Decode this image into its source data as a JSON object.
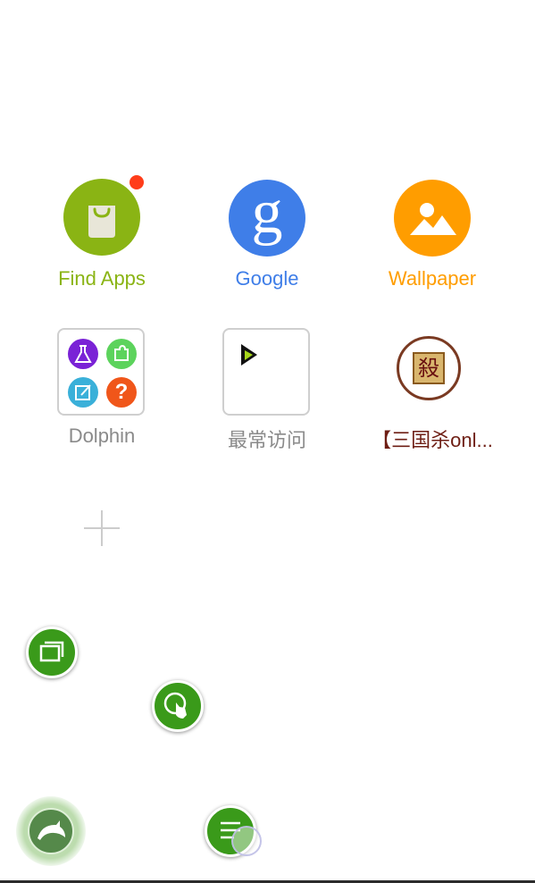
{
  "apps": [
    {
      "label": "Find Apps",
      "color": "#8ab414",
      "icon": "shopping-bag-icon",
      "badge": true,
      "badge_color": "#ff3d1a"
    },
    {
      "label": "Google",
      "color": "#3f7ee8",
      "icon": "google-icon",
      "glyph": "g"
    },
    {
      "label": "Wallpaper",
      "color": "#ff9d00",
      "icon": "image-icon"
    },
    {
      "label": "Dolphin",
      "color": "#8a8a8a",
      "icon": "folder-icon",
      "folder_items": [
        {
          "icon": "flask-icon",
          "color": "#7a22d6"
        },
        {
          "icon": "puzzle-icon",
          "color": "#5cd35c"
        },
        {
          "icon": "edit-icon",
          "color": "#3ab0d9"
        },
        {
          "icon": "help-icon",
          "color": "#f0561a",
          "glyph": "?"
        }
      ]
    },
    {
      "label": "最常访问",
      "color": "#8a8a8a",
      "icon": "most-visited-icon"
    },
    {
      "label": "【三国杀onl...",
      "color": "#6e1e14",
      "icon": "sanguosha-icon",
      "glyph": "殺"
    }
  ],
  "add_shortcut": {
    "icon": "plus-icon"
  },
  "floating_controls": [
    {
      "name": "tabs-button",
      "icon": "tabs-icon"
    },
    {
      "name": "gesture-button",
      "icon": "gesture-icon"
    },
    {
      "name": "dolphin-button",
      "icon": "dolphin-icon"
    },
    {
      "name": "menu-button",
      "icon": "menu-icon"
    }
  ]
}
